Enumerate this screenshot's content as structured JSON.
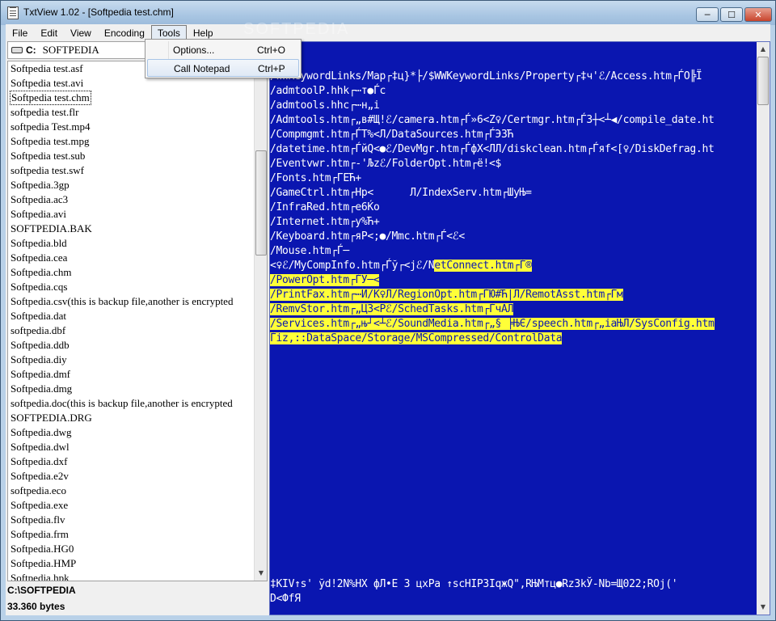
{
  "window": {
    "title": "TxtView 1.02 - [Softpedia test.chm]",
    "minimize_glyph": "─",
    "maximize_glyph": "☐",
    "close_glyph": "✕"
  },
  "menubar": {
    "items": [
      "File",
      "Edit",
      "View",
      "Encoding",
      "Tools",
      "Help"
    ]
  },
  "tools_menu": {
    "items": [
      {
        "label": "Options...",
        "shortcut": "Ctrl+O"
      },
      {
        "label": "Call Notepad",
        "shortcut": "Ctrl+P"
      }
    ]
  },
  "drive": {
    "letter": "C:",
    "label": "SOFTPEDIA"
  },
  "files": [
    "Softpedia test.asf",
    "Softpedia test.avi",
    "Softpedia test.chm",
    "softpedia test.flr",
    "softpedia Test.mp4",
    "Softpedia test.mpg",
    "Softpedia test.sub",
    "softpedia test.swf",
    "Softpedia.3gp",
    "Softpedia.ac3",
    "Softpedia.avi",
    "SOFTPEDIA.BAK",
    "Softpedia.bld",
    "Softpedia.cea",
    "Softpedia.chm",
    "Softpedia.cqs",
    "Softpedia.csv(this is backup file,another is encrypted",
    "Softpedia.dat",
    "softpedia.dbf",
    "Softpedia.ddb",
    "Softpedia.diy",
    "Softpedia.dmf",
    "Softpedia.dmg",
    "softpedia.doc(this is backup file,another is encrypted",
    "SOFTPEDIA.DRG",
    "Softpedia.dwg",
    "Softpedia.dwl",
    "Softpedia.dxf",
    "Softpedia.e2v",
    "softpedia.eco",
    "Softpedia.exe",
    "Softpedia.flv",
    "Softpedia.frm",
    "Softpedia.HG0",
    "Softpedia.HMP",
    "Softpedia.hpk"
  ],
  "selected_file": "Softpedia test.chm",
  "status": {
    "path": "C:\\SOFTPEDIA",
    "size": "33.360 bytes"
  },
  "watermark": "SOFTPEDIA",
  "text_lines": [
    {
      "plain": "/WWKeywordLinks/Map┌‡ц}*├/$WWKeywordLinks/Property┌‡ч'ℰ/Access.htm┌ЃО╠Ї",
      "hl": ""
    },
    {
      "plain": "/admtoolP.hhk┌⋯т●Ѓc",
      "hl": ""
    },
    {
      "plain": "/admtools.hhc┌⋯н„i",
      "hl": ""
    },
    {
      "plain": "/Admtools.htm┌„в#Щ!ℰ/camera.htm┌Ѓ»6<Z♀/Certmgr.htm┌Ѓ3┼<┴◀/compile_date.ht",
      "hl": ""
    },
    {
      "plain": "/Compmgmt.htm┌ЃT%<Л/DataSources.htm┌ЃЭ3Ћ",
      "hl": ""
    },
    {
      "plain": "/datetime.htm┌ЃйQ<●ℰ/DevMgr.htm┌ЃфX<ЛЛ/diskclean.htm┌Ѓяf<[♀/DiskDefrag.ht",
      "hl": ""
    },
    {
      "plain": "/Eventvwr.htm┌‐'Љzℰ/FolderOpt.htm┌ё!<$",
      "hl": ""
    },
    {
      "plain": "/Fonts.htm┌ГЕЋ+",
      "hl": ""
    },
    {
      "plain": "/GameCtrl.htm┌Нр<      Л/IndexServ.htm┌ШуЊ=",
      "hl": ""
    },
    {
      "plain": "/InfraRed.htm┌е6Ќо",
      "hl": ""
    },
    {
      "plain": "/Internet.htm┌у%Ћ+",
      "hl": ""
    },
    {
      "plain": "/Keyboard.htm┌яР<;●/Mmc.htm┌Ѓ<ℰ<",
      "hl": ""
    },
    {
      "plain": "/Mouse.htm┌Ѓ─",
      "hl": ""
    },
    {
      "plain": "<♀ℰ/MyCompInfo.htm┌Ѓў┌<jℰ/N",
      "hl": "etConnect.htm┌Ѓ®"
    },
    {
      "plain": "",
      "hl": "/PowerOpt.htm┌ЃУ─<"
    },
    {
      "plain": "",
      "hl": "/PrintFax.htm┌⋯И/К♀Л/RegionOpt.htm┌ЃЮ#Ћ|Л/RemotAsst.htm┌Ѓм"
    },
    {
      "plain": "",
      "hl": "/RemvStor.htm┌„ЦЗ<Рℰ/SchedTasks.htm┌ЃчАЛ"
    },
    {
      "plain": "",
      "hl": "/Services.htm┌„њ┘<┴ℰ/SoundMedia.htm┌„§ ╞ЊЄ/speech.htm┌„іаЊЛ/SysConfig.htm"
    },
    {
      "plain": "",
      "hl": "Ѓiz,::DataSpace/Storage/MSCompressed/ControlData"
    },
    {
      "plain": "‡KIV↑s' ўd!2N%НХ фЛ•Е З цхРа ↑scHIP3IqжQ\",RЊМтц●Rz3kЎ-Nb=Щ022;RОj('",
      "hl": ""
    },
    {
      "plain": "D<ФfЯ",
      "hl": ""
    }
  ]
}
